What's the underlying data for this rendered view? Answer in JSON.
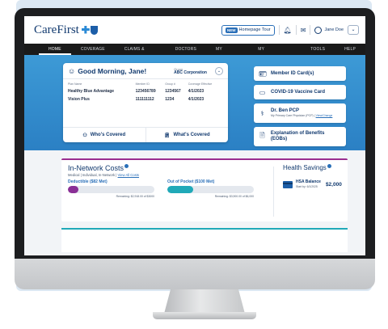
{
  "brand": {
    "logo_text": "CareFirst"
  },
  "header": {
    "homepage_tour_badge": "NEW",
    "homepage_tour_label": "Homepage Tour",
    "user_name": "Jane Doe"
  },
  "nav": {
    "items": [
      {
        "label": "HOME",
        "active": true
      },
      {
        "label": "COVERAGE",
        "active": false
      },
      {
        "label": "CLAIMS & EOBs",
        "active": false
      },
      {
        "label": "DOCTORS",
        "active": false
      },
      {
        "label": "MY HEALTH",
        "active": false
      },
      {
        "label": "MY DOCUMENTS",
        "active": false
      },
      {
        "label": "TOOLS",
        "active": false
      },
      {
        "label": "HELP",
        "active": false
      }
    ]
  },
  "greeting": {
    "title": "Good Morning, Jane!",
    "group_label": "Group",
    "group_value": "ABC Corporation",
    "columns": [
      "Plan Name",
      "Member ID",
      "Group #",
      "Coverage Effective"
    ],
    "plans": [
      [
        "Healthy Blue Advantage",
        "123456789",
        "1234567",
        "4/1/2023"
      ],
      [
        "Vision Plus",
        "111111112",
        "1234",
        "4/1/2023"
      ]
    ],
    "whos_covered": "Who's Covered",
    "whats_covered": "What's Covered"
  },
  "quick_links": {
    "member_id": "Member ID Card(s)",
    "covid": "COVID-19 Vaccine Card",
    "pcp_name": "Dr. Ben PCP",
    "pcp_sub": "My Primary Care Physician (PCP)",
    "pcp_link": "View/Change",
    "eob": "Explanation of Benefits (EOBs)"
  },
  "costs": {
    "title": "In-Network Costs",
    "subtitle": "Medical | Individual, In-Network |",
    "view_all": "View All Costs",
    "deductible_label": "Deductible ($82 Met)",
    "deductible_remaining": "Remaining: $2,918.00 of $3000",
    "deductible_fraction": 0.12,
    "oop_label": "Out of Pocket ($100 Met)",
    "oop_remaining": "Remaining: $3,900.00 of $6,000",
    "oop_fraction": 0.3
  },
  "savings": {
    "title": "Health Savings",
    "hsa_label": "HSA Balance",
    "hsa_date": "Start by: 6/1/2025",
    "hsa_amount": "$2,000"
  },
  "colors": {
    "hero": "#3d9ad6",
    "deductible": "#8a2f96",
    "oop": "#20a9b8",
    "accent": "#123a6f"
  }
}
